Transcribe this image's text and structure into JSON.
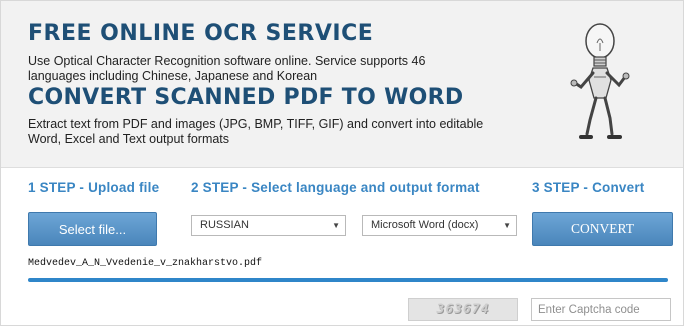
{
  "hero": {
    "title1": "FREE ONLINE OCR SERVICE",
    "desc1": "Use Optical Character Recognition software online. Service supports 46 languages including Chinese, Japanese and Korean",
    "title2": "CONVERT SCANNED PDF TO WORD",
    "desc2": "Extract text from PDF and images (JPG, BMP, TIFF, GIF) and convert into editable Word, Excel and Text output formats",
    "mascot_icon": "lightbulb-robot-icon"
  },
  "steps": {
    "step1": "1 STEP - Upload file",
    "step2": "2 STEP - Select language and output format",
    "step3": "3 STEP - Convert"
  },
  "upload": {
    "button_label": "Select file...",
    "filename": "Medvedev_A_N_Vvedenie_v_znakharstvo.pdf",
    "progress": 1.0
  },
  "options": {
    "language": "RUSSIAN",
    "format": "Microsoft Word (docx)"
  },
  "convert": {
    "button_label": "CONVERT"
  },
  "captcha": {
    "code": "363674",
    "placeholder": "Enter Captcha code"
  },
  "colors": {
    "heading": "#1e4f76",
    "step": "#3a86c3",
    "button": "#5b97c9",
    "progress": "#2f86c9"
  }
}
